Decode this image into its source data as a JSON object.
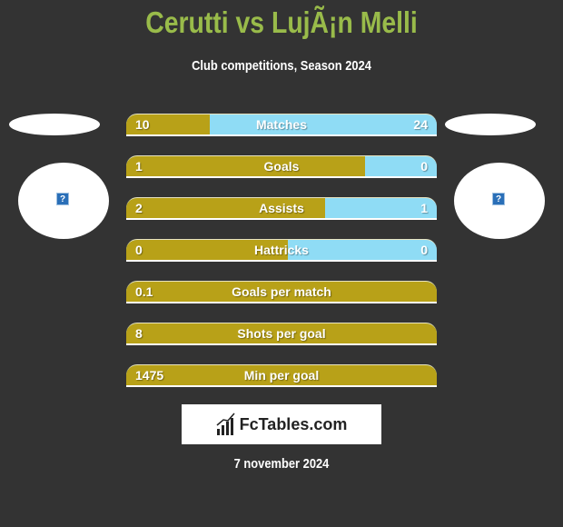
{
  "header": {
    "title": "Cerutti vs LujÃ¡n Melli",
    "subtitle": "Club competitions, Season 2024"
  },
  "colors": {
    "left_bar": "#b8a118",
    "right_bar": "#8fdcf5",
    "title": "#99bb4a",
    "background": "#333333"
  },
  "players": {
    "left": {
      "image_icon": "broken-image-icon",
      "placeholder_glyph": "?"
    },
    "right": {
      "image_icon": "broken-image-icon",
      "placeholder_glyph": "?"
    }
  },
  "stats": [
    {
      "label": "Matches",
      "left": "10",
      "right": "24",
      "left_share": 0.27
    },
    {
      "label": "Goals",
      "left": "1",
      "right": "0",
      "left_share": 0.77
    },
    {
      "label": "Assists",
      "left": "2",
      "right": "1",
      "left_share": 0.64
    },
    {
      "label": "Hattricks",
      "left": "0",
      "right": "0",
      "left_share": 0.52
    },
    {
      "label": "Goals per match",
      "left": "0.1",
      "right": "",
      "left_share": 1.0
    },
    {
      "label": "Shots per goal",
      "left": "8",
      "right": "",
      "left_share": 1.0
    },
    {
      "label": "Min per goal",
      "left": "1475",
      "right": "",
      "left_share": 1.0
    }
  ],
  "footer": {
    "logo_text": "FcTables.com",
    "date": "7 november 2024"
  }
}
